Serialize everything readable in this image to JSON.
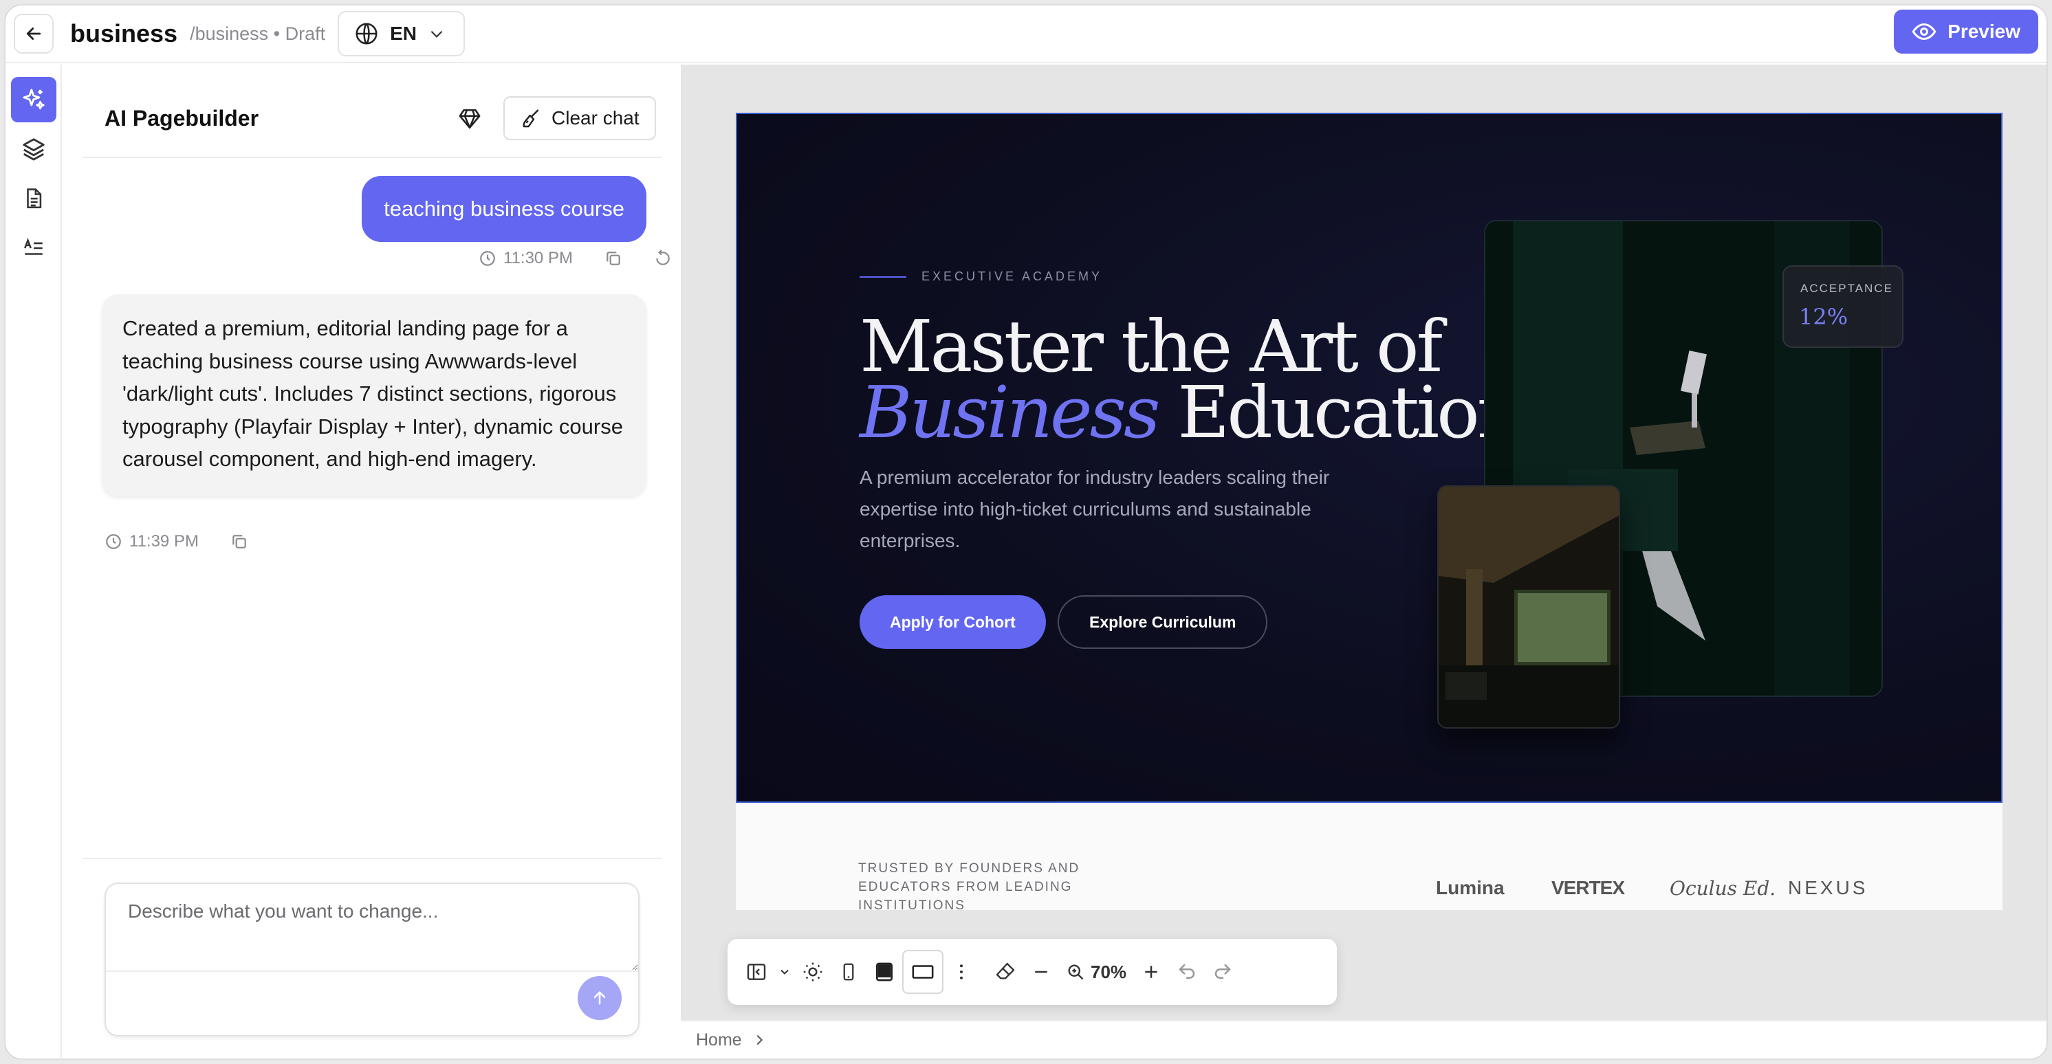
{
  "topbar": {
    "title": "business",
    "path": "/business • Draft",
    "language": "EN",
    "preview_label": "Preview"
  },
  "chat": {
    "title": "AI Pagebuilder",
    "clear_label": "Clear chat",
    "user_message": "teaching business course",
    "user_time": "11:30 PM",
    "ai_message": "Created a premium, editorial landing page for a teaching business course using Awwwards-level 'dark/light cuts'. Includes 7 distinct sections, rigorous typography (Playfair Display + Inter), dynamic course carousel component, and high-end imagery.",
    "ai_time": "11:39 PM",
    "composer_placeholder": "Describe what you want to change..."
  },
  "site": {
    "eyebrow": "EXECUTIVE ACADEMY",
    "headline_line1": "Master the Art of",
    "headline_accent": "Business",
    "headline_rest": " Education.",
    "subtitle": "A premium accelerator for industry leaders scaling their expertise into high-ticket curriculums and sustainable enterprises.",
    "primary_cta": "Apply for Cohort",
    "secondary_cta": "Explore Curriculum",
    "stat_label": "ACCEPTANCE",
    "stat_value": "12%",
    "trust_text": "TRUSTED BY FOUNDERS AND EDUCATORS FROM LEADING INSTITUTIONS",
    "logos": [
      "Lumina",
      "VERTEX",
      "Oculus Ed.",
      "NEXUS"
    ]
  },
  "toolbar": {
    "zoom": "70%"
  },
  "breadcrumb": {
    "home": "Home"
  },
  "colors": {
    "accent": "#6366f1",
    "hero_bg": "#0c0d1e"
  }
}
